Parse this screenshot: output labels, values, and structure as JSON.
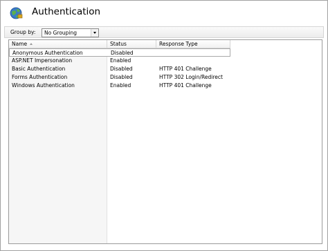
{
  "page": {
    "title": "Authentication"
  },
  "toolbar": {
    "group_by_label": "Group by:",
    "group_by_value": "No Grouping"
  },
  "table": {
    "columns": [
      {
        "label": "Name"
      },
      {
        "label": "Status"
      },
      {
        "label": "Response Type"
      }
    ],
    "rows": [
      {
        "name": "Anonymous Authentication",
        "status": "Disabled",
        "response_type": ""
      },
      {
        "name": "ASP.NET Impersonation",
        "status": "Enabled",
        "response_type": ""
      },
      {
        "name": "Basic Authentication",
        "status": "Disabled",
        "response_type": "HTTP 401 Challenge"
      },
      {
        "name": "Forms Authentication",
        "status": "Disabled",
        "response_type": "HTTP 302 Login/Redirect"
      },
      {
        "name": "Windows Authentication",
        "status": "Enabled",
        "response_type": "HTTP 401 Challenge"
      }
    ]
  },
  "icons": {
    "feature": "globe-lock-icon",
    "sort": "sort-ascending-icon",
    "dropdown": "chevron-down-icon"
  }
}
